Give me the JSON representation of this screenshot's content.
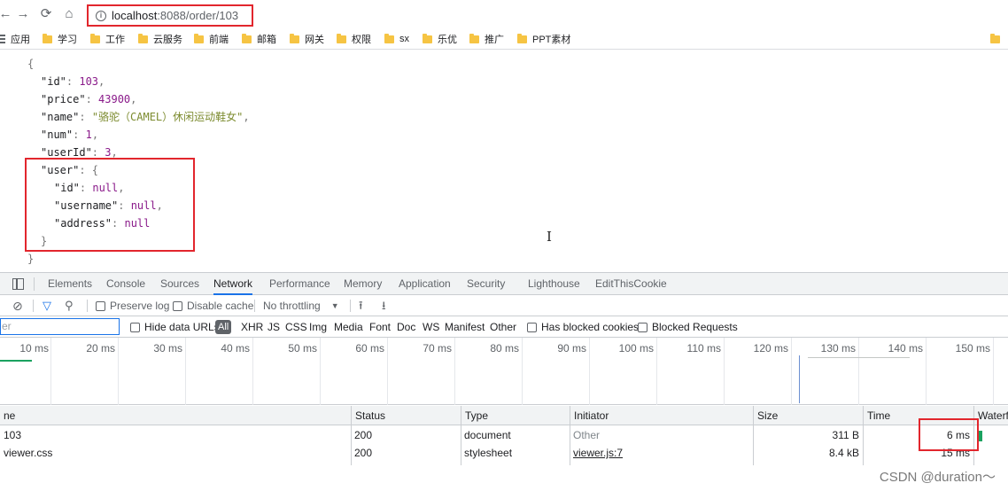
{
  "browser": {
    "url_host": "localhost",
    "url_path": ":8088/order/103",
    "bookmarks": [
      "应用",
      "学习",
      "工作",
      "云服务",
      "前端",
      "邮箱",
      "网关",
      "权限",
      "sx",
      "乐优",
      "推广",
      "PPT素材"
    ]
  },
  "json_view": {
    "open_brace": "{",
    "close_brace": "}",
    "id": "103",
    "price": "43900",
    "name": "\"骆驼（CAMEL）休闲运动鞋女\"",
    "num": "1",
    "userId": "3",
    "user_id": "null",
    "user_username": "null",
    "user_address": "null"
  },
  "devtools": {
    "tabs": [
      "Elements",
      "Console",
      "Sources",
      "Network",
      "Performance",
      "Memory",
      "Application",
      "Security",
      "Lighthouse",
      "EditThisCookie"
    ],
    "active_tab": "Network",
    "toolbar": {
      "preserve_log": "Preserve log",
      "disable_cache": "Disable cache",
      "throttling": "No throttling"
    },
    "filter": {
      "input_value": "er",
      "hide_data_urls": "Hide data URLs",
      "types": [
        "All",
        "XHR",
        "JS",
        "CSS",
        "Img",
        "Media",
        "Font",
        "Doc",
        "WS",
        "Manifest",
        "Other"
      ],
      "has_blocked_cookies": "Has blocked cookies",
      "blocked_requests": "Blocked Requests"
    },
    "timeline_ticks": [
      "10 ms",
      "20 ms",
      "30 ms",
      "40 ms",
      "50 ms",
      "60 ms",
      "70 ms",
      "80 ms",
      "90 ms",
      "100 ms",
      "110 ms",
      "120 ms",
      "130 ms",
      "140 ms",
      "150 ms"
    ],
    "columns": [
      "ne",
      "Status",
      "Type",
      "Initiator",
      "Size",
      "Time",
      "Waterfa"
    ],
    "rows": [
      {
        "name": "103",
        "status": "200",
        "type": "document",
        "initiator": "Other",
        "size": "311 B",
        "time": "6 ms"
      },
      {
        "name": "viewer.css",
        "status": "200",
        "type": "stylesheet",
        "initiator": "viewer.js:7",
        "size": "8.4 kB",
        "time": "15 ms"
      }
    ]
  },
  "watermark": "CSDN @duration～"
}
